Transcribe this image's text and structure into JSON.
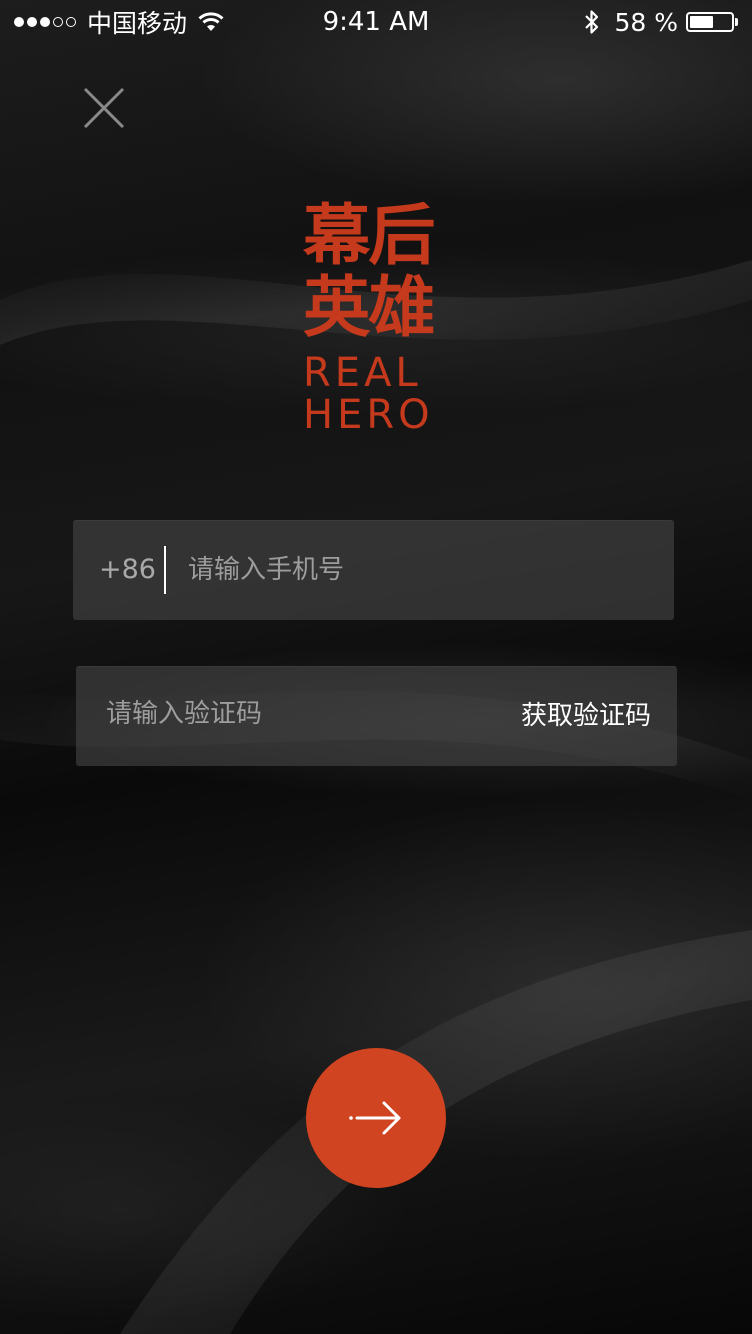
{
  "status_bar": {
    "signal_icon": "signal-dots-icon",
    "carrier": "中国移动",
    "wifi_icon": "wifi-icon",
    "time": "9:41 AM",
    "bluetooth_icon": "bluetooth-icon",
    "battery_percent": "58 %",
    "battery_level": 0.58
  },
  "header": {
    "close_icon": "close-icon"
  },
  "logo": {
    "line1": "幕后",
    "line2": "英雄",
    "line3": "REAL",
    "line4": "HERO",
    "color": "#c5391c"
  },
  "form": {
    "country_code": "+86",
    "phone_placeholder": "请输入手机号",
    "phone_value": "",
    "code_placeholder": "请输入验证码",
    "code_value": "",
    "get_code_label": "获取验证码"
  },
  "submit": {
    "icon": "arrow-right-icon",
    "color": "#d04421"
  }
}
